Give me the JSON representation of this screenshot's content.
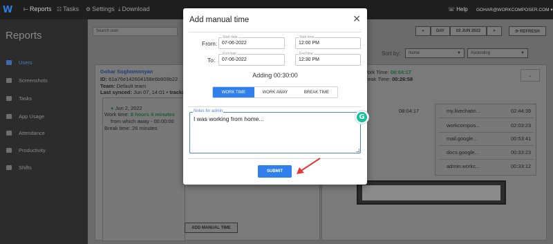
{
  "topbar": {
    "logo": "W",
    "nav": [
      {
        "icon": "chart-icon",
        "glyph": "⊢",
        "label": "Reports"
      },
      {
        "icon": "tasks-icon",
        "glyph": "☷",
        "label": "Tasks"
      },
      {
        "icon": "gear-icon",
        "glyph": "⚙",
        "label": "Settings"
      },
      {
        "icon": "download-icon",
        "glyph": "⤓",
        "label": "Download"
      }
    ],
    "help_label": "Help",
    "account_email": "GOHAR@WORKCOMPOSER.COM"
  },
  "sidebar": {
    "title": "Reports",
    "items": [
      {
        "label": "Users",
        "icon": "users-icon"
      },
      {
        "label": "Screenshots",
        "icon": "screenshots-icon"
      },
      {
        "label": "Tasks",
        "icon": "tasks-icon"
      },
      {
        "label": "App Usage",
        "icon": "app-usage-icon"
      },
      {
        "label": "Attendance",
        "icon": "attendance-icon"
      },
      {
        "label": "Productivity",
        "icon": "productivity-icon"
      },
      {
        "label": "Shifts",
        "icon": "shifts-icon"
      }
    ]
  },
  "main": {
    "search_placeholder": "Search user",
    "date_controls": {
      "prev": "«",
      "unit": "DAY",
      "date": "02 JUN 2022",
      "next": "»",
      "refresh": "⟳ REFRESH"
    },
    "sort": {
      "label": "Sort by:",
      "field": "Name",
      "order": "Ascending"
    },
    "user": {
      "name": "Gohar Soghomonyan",
      "id_label": "ID:",
      "id_value": "61a76e142604158e6b909b22",
      "team_label": "Team:",
      "team_value": "Default team",
      "synced_label": "Last synced:",
      "synced_value": "Jun 07, 14:01",
      "tracking": "• tracking"
    },
    "day": {
      "date": "Jun 2, 2022",
      "work_label": "Work time:",
      "work_value": "8 hours 4 minutes",
      "away_text": "from which away - 00:00:00",
      "break_label": "Break time:",
      "break_value": "26 minutes"
    },
    "add_manual_time": "ADD MANUAL TIME",
    "summary": {
      "work_label": "Work Time:",
      "work_value": "08:04:17",
      "break_label": "Break Time:",
      "break_value": "00:26:58"
    },
    "total_time": "08:04:17",
    "apps": [
      {
        "name": "my.livechatin...",
        "time": "02:44:39"
      },
      {
        "name": "workcompos...",
        "time": "02:03:23"
      },
      {
        "name": "mail.google...",
        "time": "00:53:41"
      },
      {
        "name": "docs.google...",
        "time": "00:33:23"
      },
      {
        "name": "admin.workc...",
        "time": "00:33:12"
      }
    ]
  },
  "modal": {
    "title": "Add manual time",
    "from_label": "From:",
    "to_label": "To:",
    "start_date_label": "Start date",
    "start_date": "07-06-2022",
    "start_time_label": "Start time",
    "start_time": "12:00 PM",
    "end_date_label": "End date",
    "end_date": "07-06-2022",
    "end_time_label": "End time",
    "end_time": "12:30 PM",
    "adding_text": "Adding 00:30:00",
    "tabs": [
      "WORK TIME",
      "WORK AWAY",
      "BREAK TIME"
    ],
    "active_tab": 0,
    "notes_label": "Notes for admin",
    "notes_value": "I was working from home...",
    "grammarly": "G",
    "submit": "SUBMIT"
  },
  "colors": {
    "accent": "#2f80ed",
    "annotation_arrow": "#e53935",
    "grammarly": "#15c39a"
  }
}
